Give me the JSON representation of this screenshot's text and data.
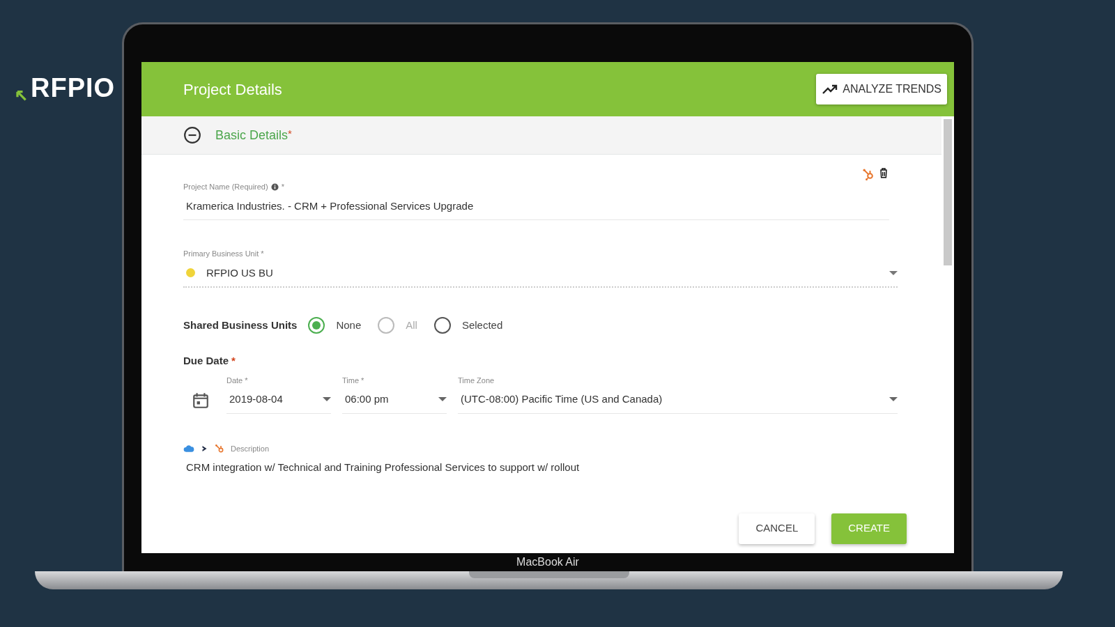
{
  "brand": {
    "logo_text": "RFPIO"
  },
  "device": {
    "label": "MacBook Air"
  },
  "header": {
    "title": "Project Details",
    "action": "ANALYZE TRENDS"
  },
  "section": {
    "title": "Basic Details",
    "required_mark": "*",
    "expanded": true
  },
  "project_name": {
    "label": "Project Name (Required)",
    "required_mark": "*",
    "value": "Kramerica Industries. - CRM + Professional Services Upgrade"
  },
  "primary_business_unit": {
    "label": "Primary Business Unit *",
    "value": "RFPIO US BU",
    "color": "#f0d43a"
  },
  "shared_business_units": {
    "label": "Shared Business Units",
    "options": [
      {
        "label": "None",
        "selected": true,
        "disabled": false
      },
      {
        "label": "All",
        "selected": false,
        "disabled": true
      },
      {
        "label": "Selected",
        "selected": false,
        "disabled": false
      }
    ]
  },
  "due_date": {
    "title": "Due Date",
    "required_mark": "*",
    "date": {
      "label": "Date *",
      "value": "2019-08-04"
    },
    "time": {
      "label": "Time *",
      "value": "06:00 pm"
    },
    "time_zone": {
      "label": "Time Zone",
      "value": "(UTC-08:00) Pacific Time (US and Canada)"
    }
  },
  "description": {
    "label": "Description",
    "value": "CRM integration w/ Technical and Training Professional Services to support w/ rollout"
  },
  "buttons": [
    {
      "label": "CANCEL",
      "kind": "secondary"
    },
    {
      "label": "CREATE",
      "kind": "primary"
    }
  ]
}
